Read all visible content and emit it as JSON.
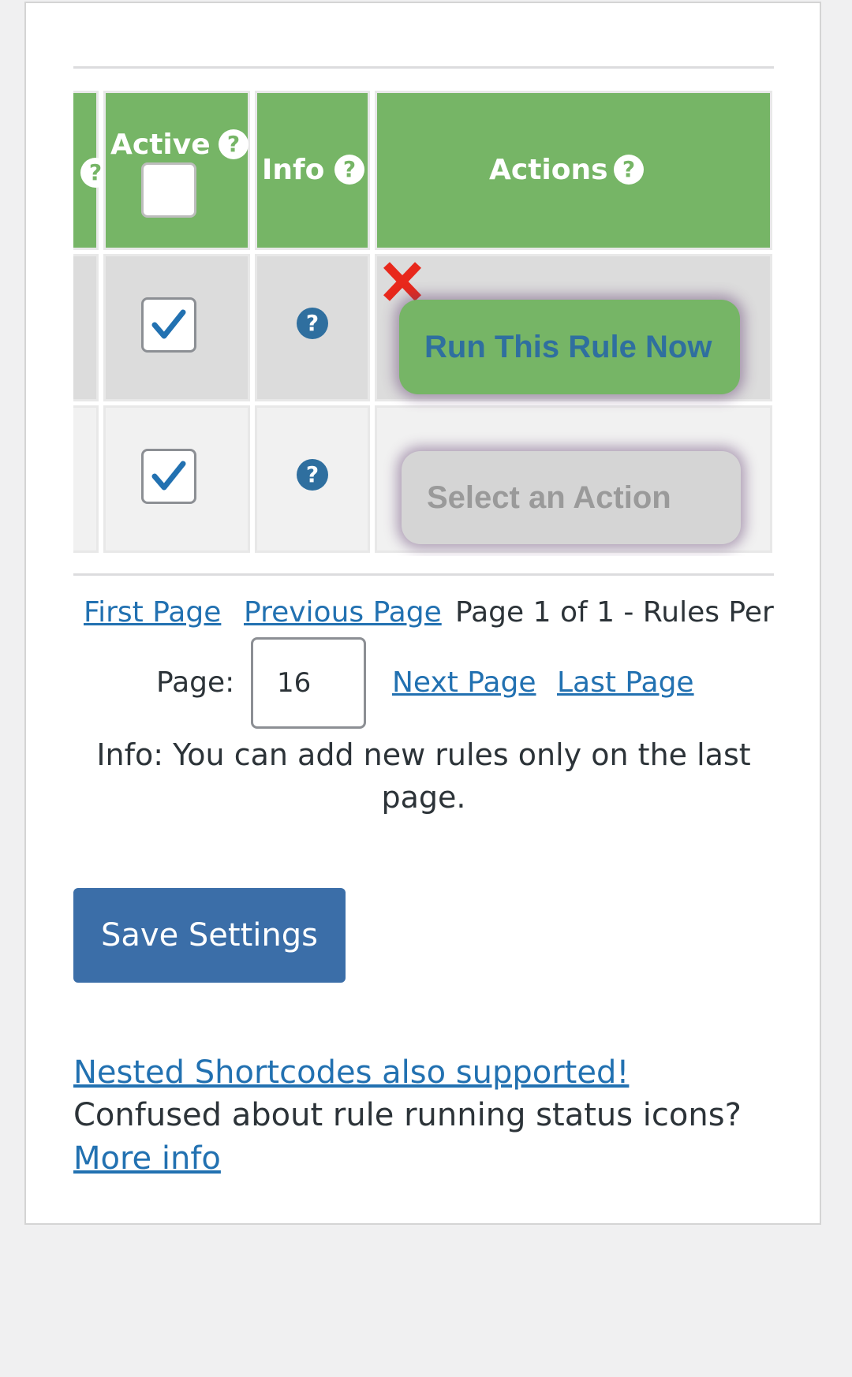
{
  "table": {
    "headers": {
      "active": "Active",
      "info": "Info",
      "actions": "Actions",
      "help_glyph": "?"
    },
    "rows": [
      {
        "active_checked": true,
        "info_glyph": "?",
        "action_label": "Run This Rule Now",
        "delete_icon": "close-x-icon"
      },
      {
        "active_checked": true,
        "info_glyph": "?",
        "action_label": "Select an Action"
      }
    ]
  },
  "pagination": {
    "first": "First Page",
    "previous": "Previous Page",
    "status": "Page 1 of 1 - Rules Per",
    "page_label": "Page:",
    "rules_per_page": "16",
    "next": "Next Page",
    "last": "Last Page",
    "info": "Info: You can add new rules only on the last page."
  },
  "save_button": "Save Settings",
  "footer": {
    "nested_link": "Nested Shortcodes also supported!",
    "confused_text": "Confused about rule running status icons?",
    "more_info_link": "More info"
  },
  "colors": {
    "header_green": "#76b566",
    "link_blue": "#2271b1",
    "save_blue": "#3b6ea8",
    "delete_red": "#e8281c"
  }
}
